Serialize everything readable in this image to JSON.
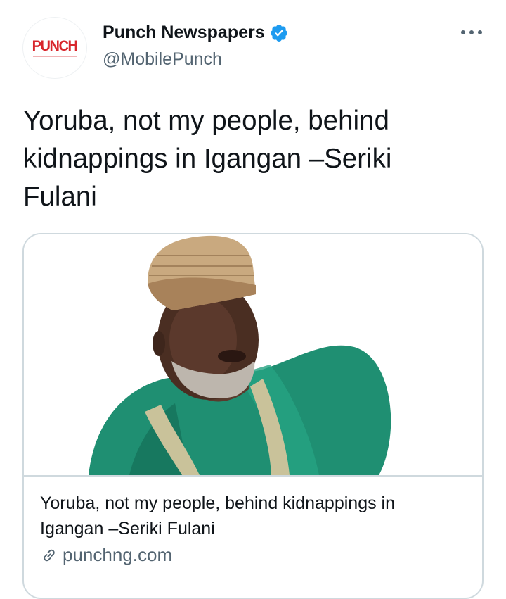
{
  "tweet": {
    "author": {
      "avatar_logo": "PUNCH",
      "name": "Punch Newspapers",
      "handle": "@MobilePunch",
      "verified_icon": "verified-badge-icon"
    },
    "more_icon": "more-horizontal-icon",
    "text": "Yoruba, not my people, behind kidnappings in Igangan –Seriki Fulani",
    "card": {
      "image_alt": "photo of a man wearing a cap and green attire",
      "title": "Yoruba, not my people, behind kidnappings in Igangan –Seriki Fulani",
      "domain": "punchng.com",
      "link_icon": "link-icon"
    }
  },
  "colors": {
    "brand_red": "#d8262c",
    "verified_blue": "#1d9bf0",
    "secondary_text": "#536471",
    "border": "#cfd9de"
  }
}
